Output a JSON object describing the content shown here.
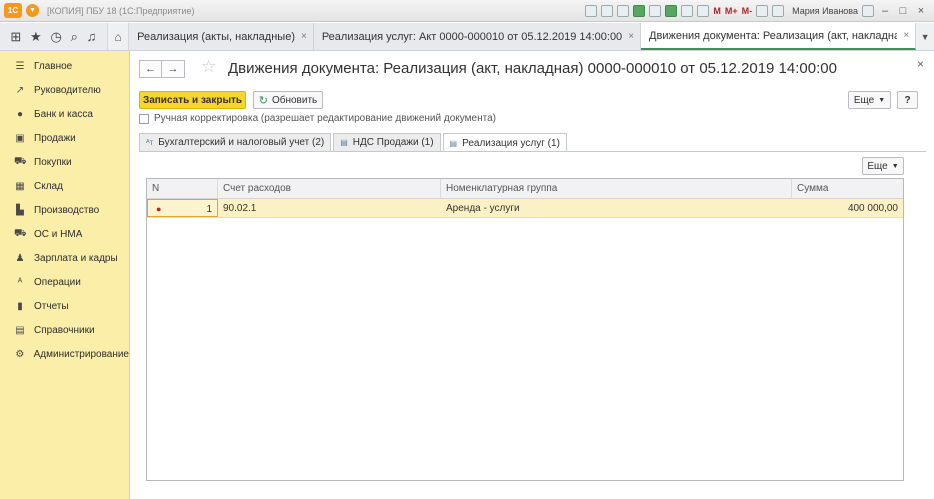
{
  "app": {
    "logo": "1С",
    "title": "[КОПИЯ] ПБУ 18  (1С:Предприятие)",
    "user": "Мария Иванова",
    "memory_buttons": [
      "M",
      "M+",
      "M-"
    ]
  },
  "tabs": [
    {
      "label": "Реализация (акты, накладные)",
      "active": false
    },
    {
      "label": "Реализация услуг: Акт 0000-000010 от 05.12.2019 14:00:00",
      "active": false
    },
    {
      "label": "Движения документа: Реализация (акт, накладная) 0000-000010 от 05.12.20...",
      "active": true
    }
  ],
  "sidebar": {
    "items": [
      {
        "label": "Главное",
        "icon": "menu-icon"
      },
      {
        "label": "Руководителю",
        "icon": "trend-icon"
      },
      {
        "label": "Банк и касса",
        "icon": "bank-icon"
      },
      {
        "label": "Продажи",
        "icon": "sales-icon"
      },
      {
        "label": "Покупки",
        "icon": "cart-icon"
      },
      {
        "label": "Склад",
        "icon": "warehouse-icon"
      },
      {
        "label": "Производство",
        "icon": "factory-icon"
      },
      {
        "label": "ОС и НМА",
        "icon": "truck-icon"
      },
      {
        "label": "Зарплата и кадры",
        "icon": "person-icon"
      },
      {
        "label": "Операции",
        "icon": "operations-icon"
      },
      {
        "label": "Отчеты",
        "icon": "reports-icon"
      },
      {
        "label": "Справочники",
        "icon": "books-icon"
      },
      {
        "label": "Администрирование",
        "icon": "gear-icon"
      }
    ]
  },
  "document": {
    "title": "Движения документа: Реализация (акт, накладная) 0000-000010 от 05.12.2019 14:00:00",
    "save_close_label": "Записать и закрыть",
    "refresh_label": "Обновить",
    "more_label": "Еще",
    "help_label": "?",
    "manual_correction_label": "Ручная корректировка (разрешает редактирование движений документа)",
    "subtabs": [
      {
        "label": "Бухгалтерский и налоговый учет (2)",
        "active": false
      },
      {
        "label": "НДС Продажи (1)",
        "active": false
      },
      {
        "label": "Реализация услуг (1)",
        "active": true
      }
    ],
    "table_more_label": "Еще",
    "table": {
      "headers": [
        "N",
        "Счет расходов",
        "Номенклатурная группа",
        "Сумма"
      ],
      "rows": [
        {
          "n": "1",
          "account": "90.02.1",
          "group": "Аренда - услуги",
          "sum": "400 000,00"
        }
      ]
    }
  }
}
